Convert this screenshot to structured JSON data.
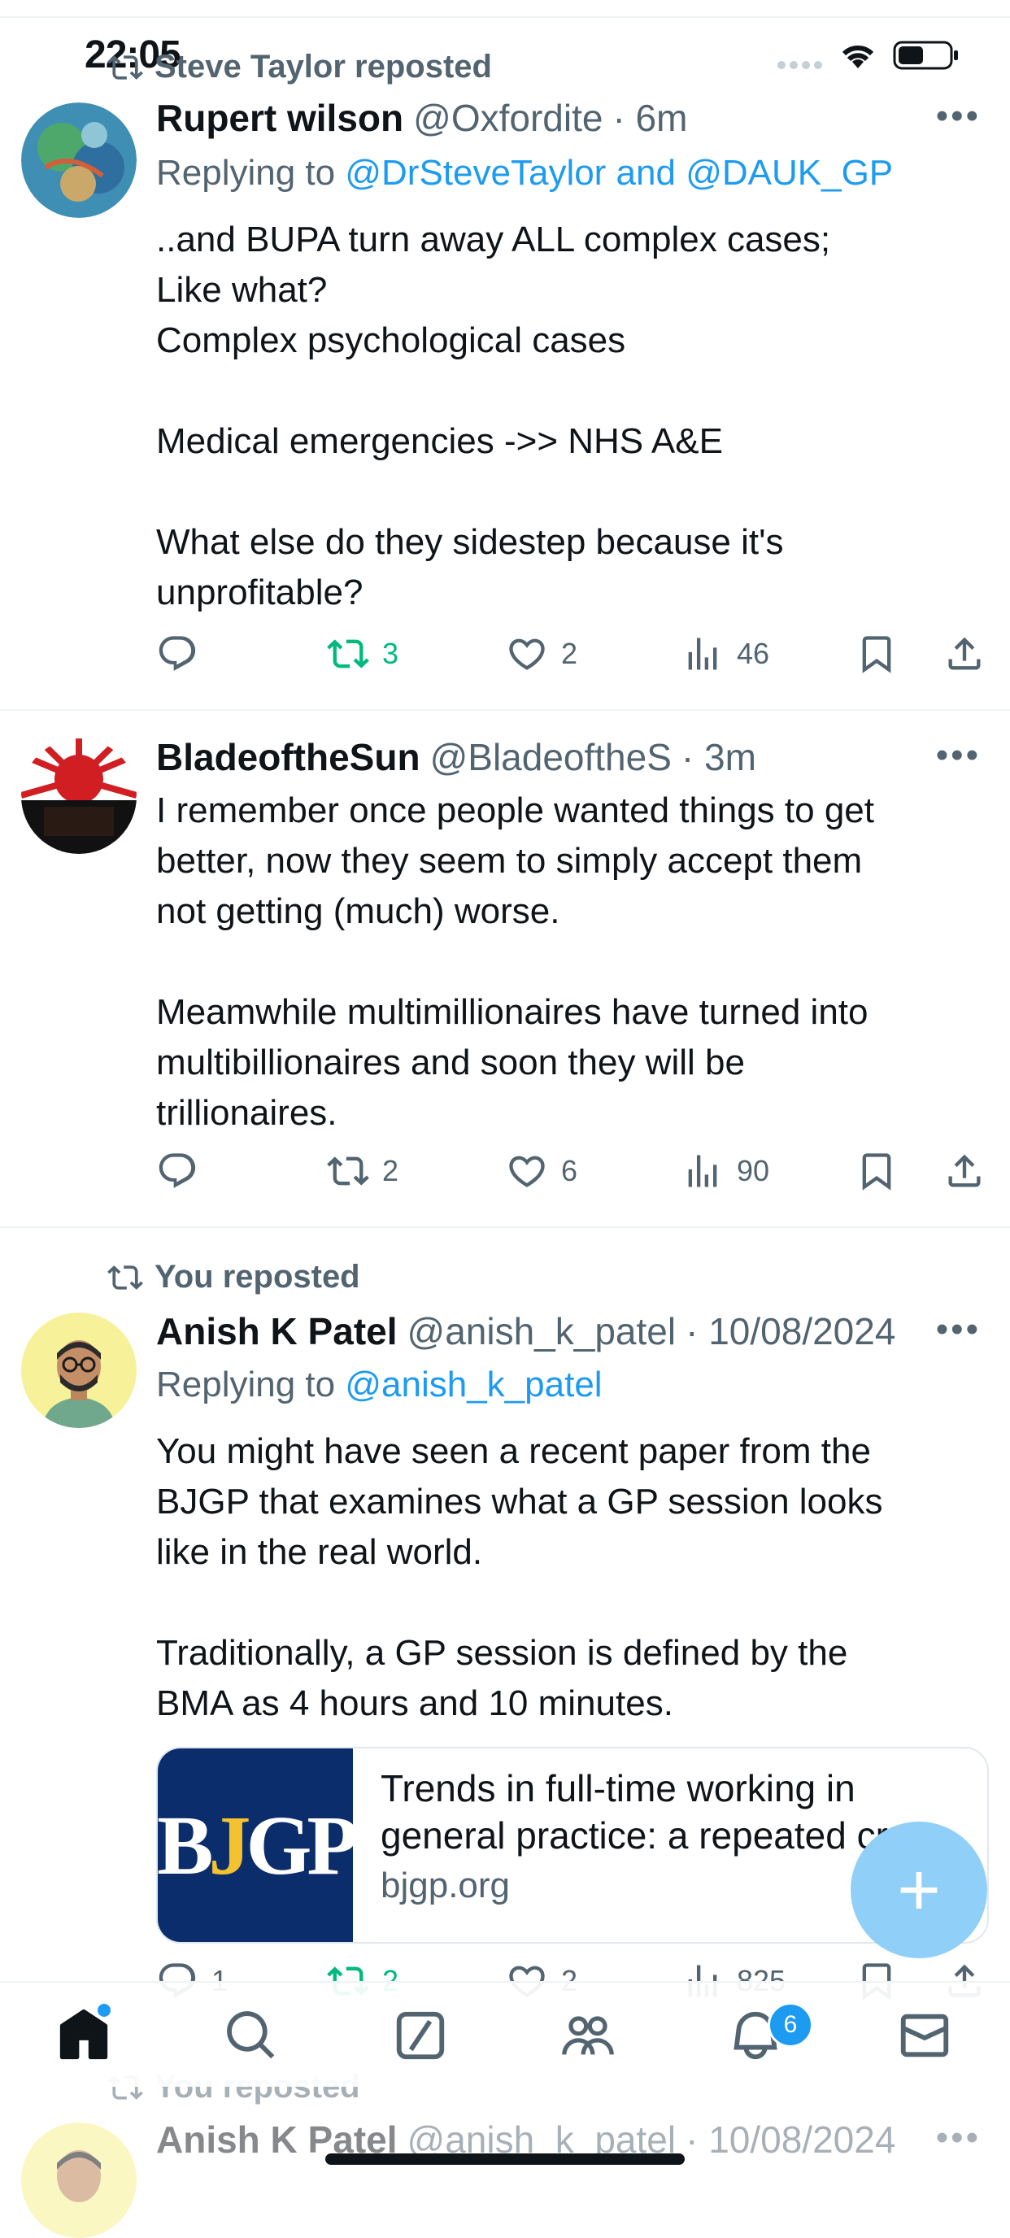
{
  "status": {
    "time": "22:05"
  },
  "tweets": [
    {
      "repost_label": "Steve Taylor reposted",
      "name": "Rupert wilson",
      "handle": "@Oxfordite",
      "time": "· 6m",
      "replying_prefix": "Replying to ",
      "replying_to": "@DrSteveTaylor and @DAUK_GP",
      "text": "..and BUPA turn away ALL complex cases;\nLike what?\nComplex psychological cases\n\nMedical emergencies ->> NHS A&E\n\nWhat else do they sidestep because it's\nunprofitable?",
      "retweets": "3",
      "likes": "2",
      "views": "46"
    },
    {
      "name": "BladeoftheSun",
      "handle": "@BladeoftheS",
      "time": "· 3m",
      "text": "I remember once people wanted things to get\nbetter, now they seem to simply accept them\nnot getting (much) worse.\n\nMeamwhile multimillionaires have turned into\nmultibillionaires and soon they will be\ntrillionaires.",
      "retweets": "2",
      "likes": "6",
      "views": "90"
    },
    {
      "repost_label": "You reposted",
      "name": "Anish K Patel",
      "handle": "@anish_k_patel",
      "time": "· 10/08/2024",
      "replying_prefix": "Replying to ",
      "replying_to": "@anish_k_patel",
      "text": "You might have seen a recent paper from the\nBJGP that examines what a GP session looks\nlike in the real world.\n\nTraditionally, a GP session is defined by the\nBMA as 4 hours and 10 minutes.",
      "card": {
        "logo_b": "B",
        "logo_j": "J",
        "logo_gp": "GP",
        "title": "Trends in full-time working in general practice: a repeated cro…",
        "domain": "bjgp.org"
      },
      "replies": "1",
      "retweets": "2",
      "likes": "2",
      "views": "825"
    },
    {
      "repost_label": "You reposted",
      "name": "Anish K Patel",
      "handle": "@anish_k_patel",
      "time": "· 10/08/2024"
    }
  ],
  "fab": {
    "symbol": "+"
  },
  "notifications": {
    "badge": "6"
  },
  "colors": {
    "accent": "#1d9bf0",
    "retweet_active": "#00ba7c",
    "secondary": "#536471"
  }
}
